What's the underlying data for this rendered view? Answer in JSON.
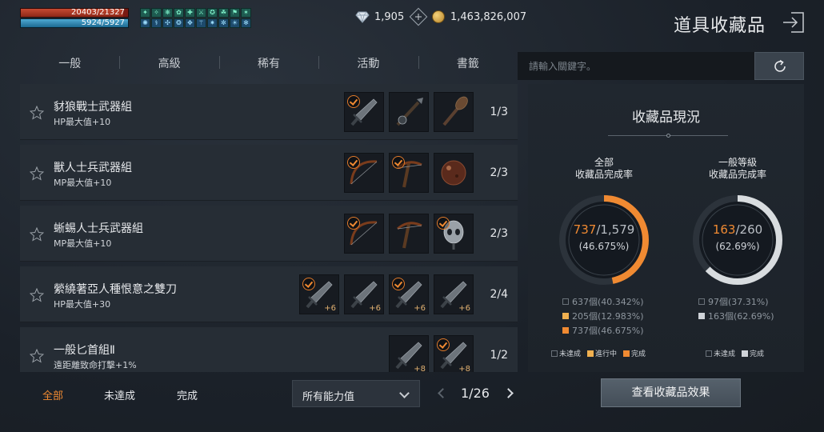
{
  "hud": {
    "hp_text": "20403/21327",
    "hp_fill": 0.957,
    "mp_text": "5924/5927",
    "mp_fill": 0.999,
    "buff_icons": [
      "✦",
      "✧",
      "❋",
      "✿",
      "✚",
      "⚔",
      "✪",
      "☘",
      "⚑",
      "✶",
      "✺",
      "⚕",
      "✣",
      "❂",
      "✥",
      "⚚",
      "✷",
      "✼",
      "☀",
      "✻"
    ]
  },
  "currency": {
    "diamonds": "1,905",
    "gold": "1,463,826,007"
  },
  "title": "道具收藏品",
  "tabs": [
    {
      "label": "一般",
      "active": true
    },
    {
      "label": "高級",
      "active": false
    },
    {
      "label": "稀有",
      "active": false
    },
    {
      "label": "活動",
      "active": false
    },
    {
      "label": "書籤",
      "active": false
    }
  ],
  "search": {
    "placeholder": "請輸入關鍵字。"
  },
  "collections": [
    {
      "name": "豺狼戰士武器組",
      "effect": "HP最大值+10",
      "progress": "1/3",
      "items": [
        {
          "icon": "dagger",
          "done": true,
          "plus": ""
        },
        {
          "icon": "short-spear",
          "done": false,
          "plus": ""
        },
        {
          "icon": "club",
          "done": false,
          "plus": ""
        }
      ]
    },
    {
      "name": "獸人士兵武器組",
      "effect": "MP最大值+10",
      "progress": "2/3",
      "items": [
        {
          "icon": "bow",
          "done": true,
          "plus": ""
        },
        {
          "icon": "crossbow",
          "done": true,
          "plus": ""
        },
        {
          "icon": "orb",
          "done": false,
          "plus": ""
        }
      ]
    },
    {
      "name": "蜥蜴人士兵武器組",
      "effect": "MP最大值+10",
      "progress": "2/3",
      "items": [
        {
          "icon": "bow",
          "done": true,
          "plus": ""
        },
        {
          "icon": "crossbow",
          "done": false,
          "plus": ""
        },
        {
          "icon": "skull",
          "done": true,
          "plus": ""
        }
      ]
    },
    {
      "name": "縈繞著亞人種恨意之雙刀",
      "effect": "HP最大值+30",
      "progress": "2/4",
      "items": [
        {
          "icon": "dagger",
          "done": true,
          "plus": "+6"
        },
        {
          "icon": "dagger",
          "done": false,
          "plus": "+6"
        },
        {
          "icon": "dagger",
          "done": true,
          "plus": "+6"
        },
        {
          "icon": "dagger",
          "done": false,
          "plus": "+6"
        }
      ]
    },
    {
      "name": "一般匕首組Ⅱ",
      "effect": "遠距離致命打擊+1%",
      "progress": "1/2",
      "items": [
        {
          "icon": "dagger",
          "done": false,
          "plus": "+8"
        },
        {
          "icon": "dagger",
          "done": true,
          "plus": "+8"
        }
      ]
    }
  ],
  "filters": {
    "all": "全部",
    "incomplete": "未達成",
    "complete": "完成",
    "active": "all"
  },
  "stat_select": "所有能力值",
  "pager": {
    "text": "1/26"
  },
  "status_panel": {
    "title": "收藏品現況",
    "overall": {
      "label_line1": "全部",
      "label_line2": "收藏品完成率",
      "done": "737",
      "total": "/1,579",
      "percent": "(46.675%)",
      "ratio": 0.46675,
      "ring_color": "#f08a32",
      "stats": [
        {
          "text": "637個(40.342%)",
          "color": "none"
        },
        {
          "text": "205個(12.983%)",
          "color": "gold"
        },
        {
          "text": "737個(46.675%)",
          "color": "orange"
        }
      ],
      "legend": [
        {
          "text": "未達成",
          "color": "none"
        },
        {
          "text": "進行中",
          "color": "gold"
        },
        {
          "text": "完成",
          "color": "orange"
        }
      ]
    },
    "normal": {
      "label_line1": "一般等級",
      "label_line2": "收藏品完成率",
      "done": "163",
      "total": "/260",
      "percent": "(62.69%)",
      "ratio": 0.6269,
      "ring_color": "#d8dcdf",
      "stats": [
        {
          "text": "97個(37.31%)",
          "color": "none"
        },
        {
          "text": "163個(62.69%)",
          "color": "gray"
        }
      ],
      "legend": [
        {
          "text": "未達成",
          "color": "none"
        },
        {
          "text": "完成",
          "color": "gray"
        }
      ]
    }
  },
  "effect_button": "查看收藏品效果"
}
